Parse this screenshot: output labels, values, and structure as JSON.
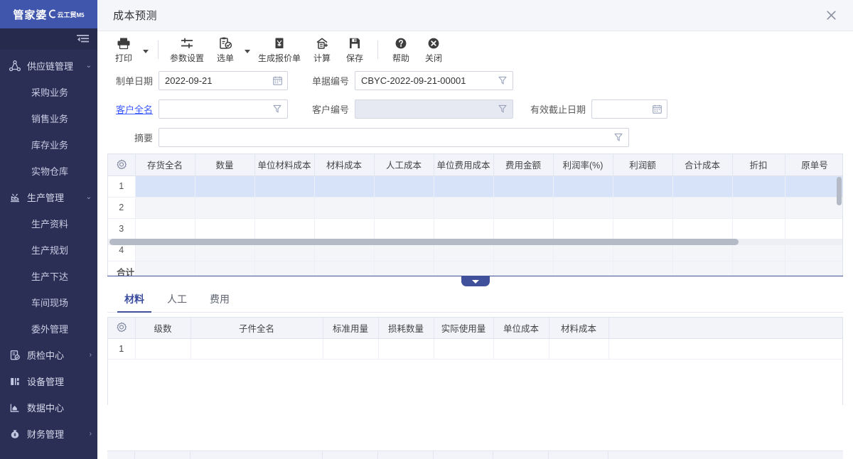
{
  "brand": {
    "name": "管家婆",
    "product": "云工贸",
    "edition": "M5",
    "collapse_icon": "collapse-sidebar-icon"
  },
  "sidebar": {
    "groups": [
      {
        "label": "供应链管理",
        "icon": "supply-chain-icon",
        "expanded": true,
        "chevron": "⌄",
        "items": [
          {
            "label": "采购业务"
          },
          {
            "label": "销售业务"
          },
          {
            "label": "库存业务"
          },
          {
            "label": "实物仓库"
          }
        ]
      },
      {
        "label": "生产管理",
        "icon": "production-icon",
        "expanded": true,
        "chevron": "⌄",
        "items": [
          {
            "label": "生产资料"
          },
          {
            "label": "生产规划"
          },
          {
            "label": "生产下达"
          },
          {
            "label": "车间现场"
          },
          {
            "label": "委外管理"
          }
        ]
      },
      {
        "label": "质检中心",
        "icon": "quality-check-icon",
        "expanded": false,
        "chevron": "›",
        "items": []
      },
      {
        "label": "设备管理",
        "icon": "equipment-icon",
        "expanded": false,
        "chevron": "",
        "items": []
      },
      {
        "label": "数据中心",
        "icon": "data-center-icon",
        "expanded": false,
        "chevron": "",
        "items": []
      },
      {
        "label": "财务管理",
        "icon": "finance-icon",
        "expanded": false,
        "chevron": "›",
        "items": []
      }
    ]
  },
  "window": {
    "title": "成本预测",
    "close_label": "✕"
  },
  "toolbar": {
    "items": [
      {
        "label": "打印",
        "icon": "printer-icon",
        "caret": true
      },
      {
        "sep": true
      },
      {
        "label": "参数设置",
        "icon": "sliders-icon",
        "caret": false
      },
      {
        "label": "选单",
        "icon": "clipboard-check-icon",
        "caret": true
      },
      {
        "label": "生成报价单",
        "icon": "quotation-icon",
        "caret": false
      },
      {
        "label": "计算",
        "icon": "calculate-icon",
        "caret": false
      },
      {
        "label": "保存",
        "icon": "save-disk-icon",
        "caret": false
      },
      {
        "sep": true
      },
      {
        "label": "帮助",
        "icon": "help-circle-icon",
        "caret": false
      },
      {
        "label": "关闭",
        "icon": "close-circle-icon",
        "caret": false
      }
    ]
  },
  "form": {
    "make_date": {
      "label": "制单日期",
      "value": "2022-09-21",
      "placeholder": "",
      "icon": "calendar-icon"
    },
    "doc_no": {
      "label": "单据编号",
      "value": "CBYC-2022-09-21-00001",
      "placeholder": "",
      "icon": "filter-icon"
    },
    "customer_name": {
      "label": "客户全名",
      "value": "",
      "placeholder": "",
      "icon": "filter-icon",
      "is_link": true
    },
    "customer_no": {
      "label": "客户编号",
      "value": "",
      "placeholder": "",
      "icon": "filter-icon",
      "disabled": true
    },
    "valid_until": {
      "label": "有效截止日期",
      "value": "",
      "placeholder": "",
      "icon": "calendar-icon"
    },
    "summary": {
      "label": "摘要",
      "value": "",
      "placeholder": "",
      "icon": "filter-icon"
    }
  },
  "main_grid": {
    "gear_icon": "settings-gear-icon",
    "columns": [
      "存货全名",
      "数量",
      "单位材料成本",
      "材料成本",
      "人工成本",
      "单位费用成本",
      "费用金额",
      "利润率(%)",
      "利润额",
      "合计成本",
      "折扣",
      "原单号"
    ],
    "rows": [
      {
        "index": "1",
        "selected": true,
        "cells": [
          "",
          "",
          "",
          "",
          "",
          "",
          "",
          "",
          "",
          "",
          "",
          ""
        ]
      },
      {
        "index": "2",
        "selected": false,
        "cells": [
          "",
          "",
          "",
          "",
          "",
          "",
          "",
          "",
          "",
          "",
          "",
          ""
        ]
      },
      {
        "index": "3",
        "selected": false,
        "cells": [
          "",
          "",
          "",
          "",
          "",
          "",
          "",
          "",
          "",
          "",
          "",
          ""
        ]
      },
      {
        "index": "4",
        "selected": false,
        "cells": [
          "",
          "",
          "",
          "",
          "",
          "",
          "",
          "",
          "",
          "",
          "",
          ""
        ]
      }
    ],
    "total_row": {
      "label": "合计",
      "cells": [
        "",
        "",
        "",
        "",
        "",
        "",
        "",
        "",
        "",
        "",
        "",
        ""
      ]
    }
  },
  "collapse_handle": {
    "name": "collapse-panel-handle",
    "glyph": "▼"
  },
  "tabs": {
    "items": [
      {
        "label": "材料",
        "active": true
      },
      {
        "label": "人工",
        "active": false
      },
      {
        "label": "费用",
        "active": false
      }
    ]
  },
  "sub_grid": {
    "gear_icon": "settings-gear-icon",
    "columns": [
      "级数",
      "子件全名",
      "标准用量",
      "损耗数量",
      "实际使用量",
      "单位成本",
      "材料成本"
    ],
    "rows": [
      {
        "index": "1",
        "cells": [
          "",
          "",
          "",
          "",
          "",
          "",
          ""
        ]
      }
    ]
  },
  "colors": {
    "brand_blue": "#4056ac",
    "sidebar_bg": "#2b2f55",
    "accent": "#41509a",
    "selected_row": "#d7e3f8",
    "header_bg": "#f2f4fa",
    "link": "#3d5afe"
  }
}
